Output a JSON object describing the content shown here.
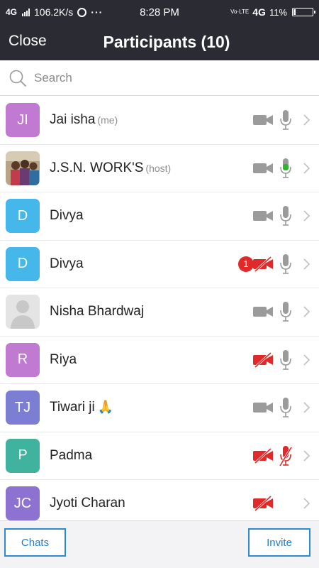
{
  "status_bar": {
    "network": "4G",
    "speed": "106.2K/s",
    "whatsapp_icon": "whatsapp-icon",
    "more": "···",
    "time": "8:28 PM",
    "volte": "Vo·LTE",
    "network_right": "4G",
    "battery": "11%",
    "battery_level": 0.11
  },
  "header": {
    "close_label": "Close",
    "title": "Participants (10)",
    "background": "#2b2b33"
  },
  "search": {
    "placeholder": "Search",
    "value": ""
  },
  "participants": [
    {
      "avatar_text": "JI",
      "avatar_color": "#c07ad2",
      "name": "Jai isha",
      "tag": "(me)",
      "video": "off",
      "audio": "muted"
    },
    {
      "avatar_text": "",
      "avatar_type": "photo",
      "name": "J.S.N. WORK'S",
      "tag": "(host)",
      "video": "off",
      "audio": "speaking"
    },
    {
      "avatar_text": "D",
      "avatar_color": "#45b7ea",
      "name": "Divya",
      "tag": "",
      "video": "off",
      "audio": "muted"
    },
    {
      "avatar_text": "D",
      "avatar_color": "#45b7ea",
      "name": "Divya",
      "tag": "",
      "video": "blocked",
      "audio": "muted",
      "badge": "1"
    },
    {
      "avatar_text": "",
      "avatar_type": "placeholder",
      "name": "Nisha Bhardwaj",
      "tag": "",
      "video": "off",
      "audio": "muted"
    },
    {
      "avatar_text": "R",
      "avatar_color": "#c07ad2",
      "name": "Riya",
      "tag": "",
      "video": "blocked",
      "audio": "muted"
    },
    {
      "avatar_text": "TJ",
      "avatar_color": "#7b7ed2",
      "name": "Tiwari ji",
      "tag": "",
      "emoji": "🙏",
      "video": "off",
      "audio": "muted"
    },
    {
      "avatar_text": "P",
      "avatar_color": "#3fb39d",
      "name": "Padma",
      "tag": "",
      "video": "blocked",
      "audio": "blocked"
    },
    {
      "avatar_text": "JC",
      "avatar_color": "#8e72d1",
      "name": "Jyoti Charan",
      "tag": "",
      "video": "blocked",
      "audio": "none"
    }
  ],
  "footer": {
    "chats_label": "Chats",
    "invite_label": "Invite",
    "accent": "#2d8ad0"
  },
  "colors": {
    "icon_gray": "#9b9b9b",
    "mic_active": "#2db52d",
    "blocked_red": "#e02a2a"
  }
}
